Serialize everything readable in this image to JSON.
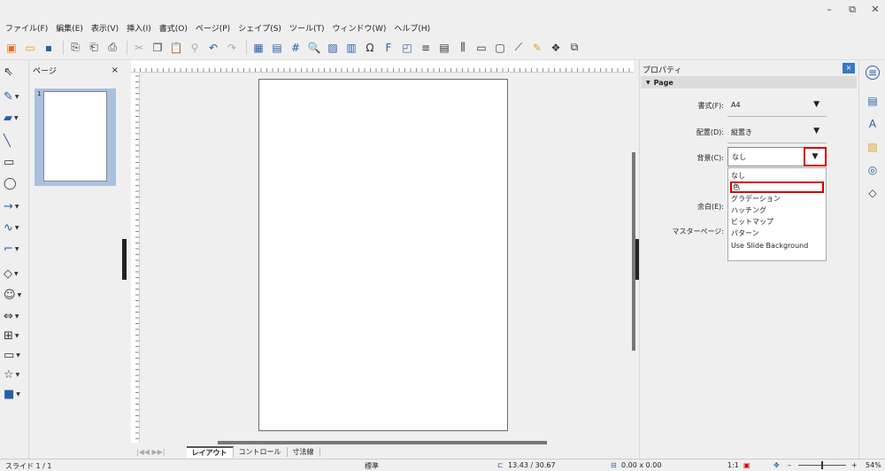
{
  "window": {
    "minimize": "–",
    "restore": "⧉",
    "close": "✕"
  },
  "menu": [
    "ファイル(F)",
    "編集(E)",
    "表示(V)",
    "挿入(I)",
    "書式(O)",
    "ページ(P)",
    "シェイプ(S)",
    "ツール(T)",
    "ウィンドウ(W)",
    "ヘルプ(H)"
  ],
  "pages_panel": {
    "title": "ページ",
    "close": "×",
    "thumb_number": "1"
  },
  "tabs": [
    "レイアウト",
    "コントロール",
    "寸法線"
  ],
  "sidebar": {
    "title": "プロパティ",
    "close": "×",
    "section": "Page",
    "format_label": "書式(F):",
    "format_value": "A4",
    "orientation_label": "配置(D):",
    "orientation_value": "縦置き",
    "background_label": "背景(C):",
    "background_value": "なし",
    "margin_label": "余白(E):",
    "master_label": "マスターページ:",
    "background_options": [
      "なし",
      "色",
      "グラデーション",
      "ハッチング",
      "ビットマップ",
      "パターン",
      "Use Slide Background"
    ]
  },
  "status": {
    "slide": "スライド 1 / 1",
    "layout": "標準",
    "position": "13.43 / 30.67",
    "size": "0.00 x 0.00",
    "scale": "1:1",
    "zoom": "54%"
  },
  "colors": {
    "accent": "#2a5ea8",
    "highlight": "#d40000"
  }
}
